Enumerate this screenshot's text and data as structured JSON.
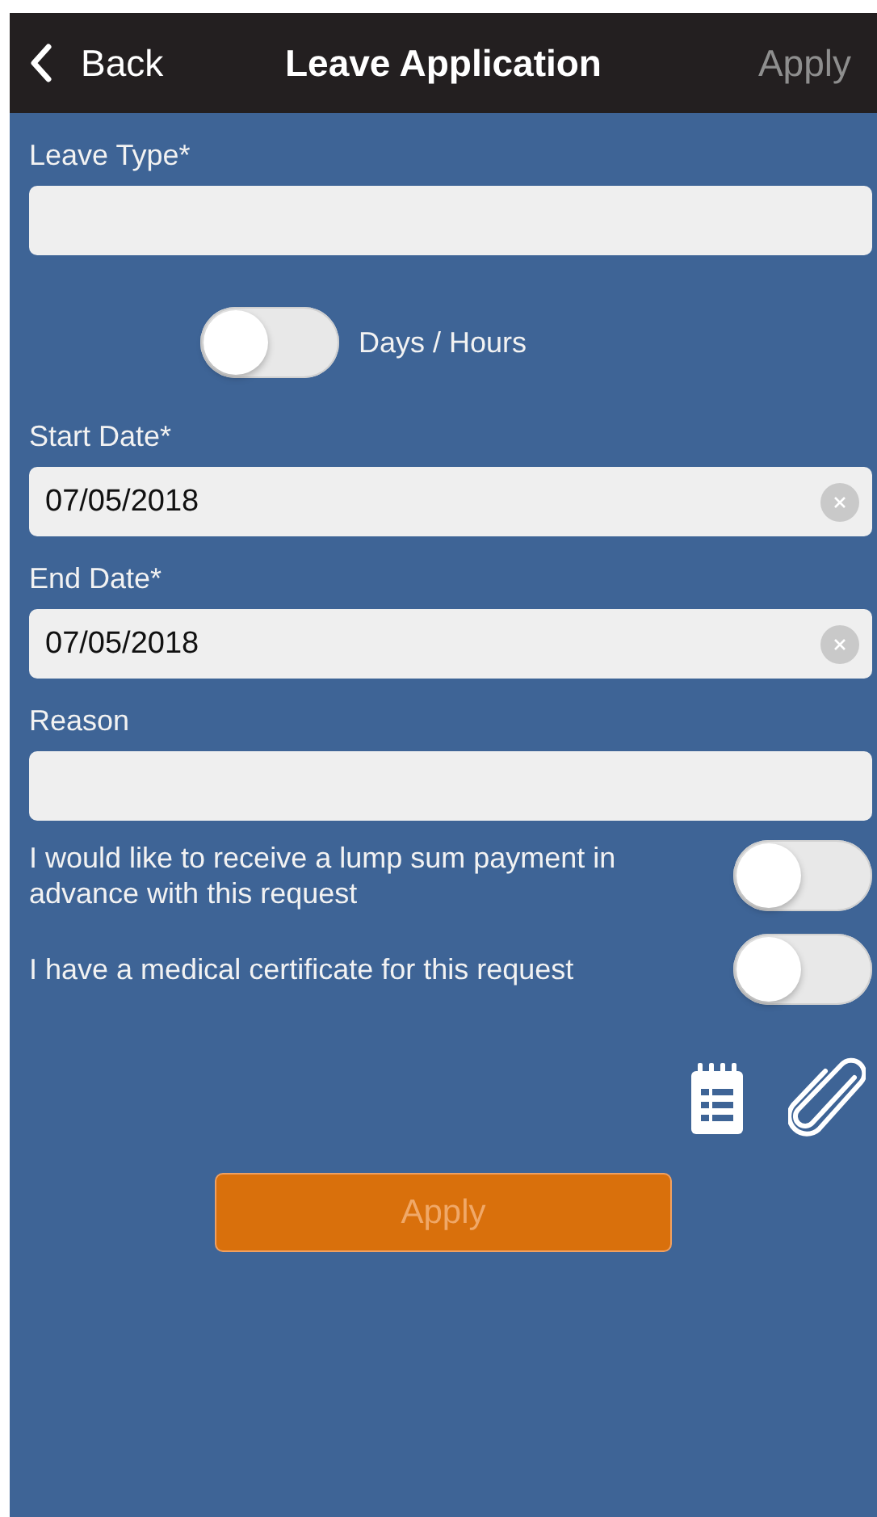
{
  "nav": {
    "back": "Back",
    "title": "Leave Application",
    "action": "Apply",
    "action_disabled": true
  },
  "fields": [
    {
      "kind": "text",
      "label": "Leave Type*"
    },
    {
      "kind": "toggle",
      "label": "Days / Hours",
      "on": false
    },
    {
      "kind": "date",
      "label": "Start Date*",
      "value": "07/05/2018"
    },
    {
      "kind": "date",
      "label": "End Date*",
      "value": "07/05/2018"
    },
    {
      "kind": "text",
      "label": "Reason"
    },
    {
      "kind": "option",
      "label": "I would like to receive a lump sum payment in advance with this request",
      "on": false
    },
    {
      "kind": "option",
      "label": "I have a medical certificate for this request",
      "on": false
    }
  ],
  "apply_button": {
    "label": "Apply",
    "disabled": true
  }
}
